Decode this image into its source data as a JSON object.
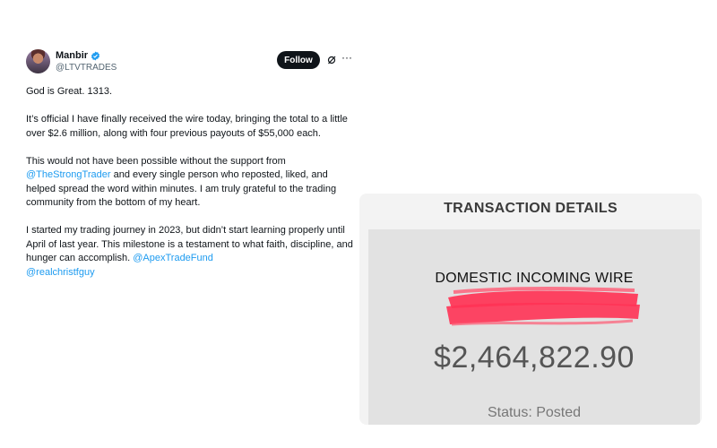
{
  "tweet": {
    "author_name": "Manbir",
    "handle": "@LTVTRADES",
    "follow_label": "Follow",
    "more_label": "···",
    "paragraphs": {
      "p1": "God is Great. 1313.",
      "p2": "It’s official I have finally received the wire today, bringing the total to a little over $2.6 million, along with four previous payouts of $55,000 each.",
      "p3_mention": "@TheStrongTrader",
      "p3_rest": " and every single person who reposted, liked, and helped spread the word within minutes. I am truly grateful to the trading community from the bottom of my heart.",
      "p3_start": "This would not have been possible without the support from ",
      "p4_text": "I started my trading journey in 2023, but didn’t start learning properly until April of last year. This milestone is a testament to what faith, discipline, and hunger can accomplish. ",
      "p4_mention1": "@ApexTradeFund",
      "p4_mention2": "@realchristfguy"
    },
    "icons": [
      "verified-badge-icon",
      "grok-icon",
      "more-icon"
    ],
    "colors": {
      "link": "#1d9bf0",
      "follow_bg": "#0f1419",
      "verified": "#1d9bf0"
    }
  },
  "transaction": {
    "title": "TRANSACTION DETAILS",
    "wire_label": "DOMESTIC INCOMING WIRE",
    "amount": "$2,464,822.90",
    "status": "Status: Posted",
    "colors": {
      "redaction": "#ff3355",
      "panel": "#e2e2e2"
    }
  }
}
